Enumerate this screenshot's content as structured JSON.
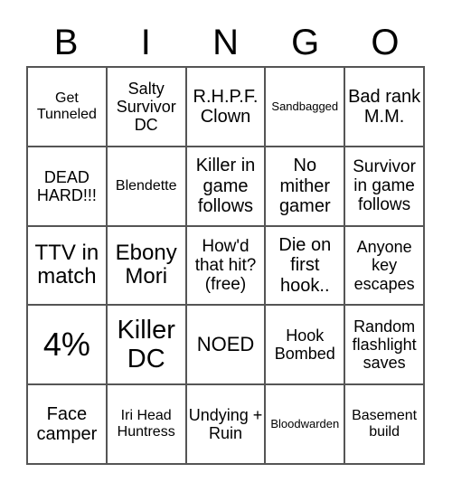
{
  "header": {
    "letters": [
      "B",
      "I",
      "N",
      "G",
      "O"
    ]
  },
  "cells": [
    [
      "Get Tunneled",
      "Salty Survivor DC",
      "R.H.P.F. Clown",
      "Sandbagged",
      "Bad rank M.M."
    ],
    [
      "DEAD HARD!!!",
      "Blendette",
      "Killer in game follows",
      "No mither gamer",
      "Survivor in game follows"
    ],
    [
      "TTV in match",
      "Ebony Mori",
      "How'd that hit? (free)",
      "Die on first hook..",
      "Anyone key escapes"
    ],
    [
      "4%",
      "Killer DC",
      "NOED",
      "Hook Bombed",
      "Random flashlight saves"
    ],
    [
      "Face camper",
      "Iri Head Huntress",
      "Undying + Ruin",
      "Bloodwarden",
      "Basement build"
    ]
  ]
}
